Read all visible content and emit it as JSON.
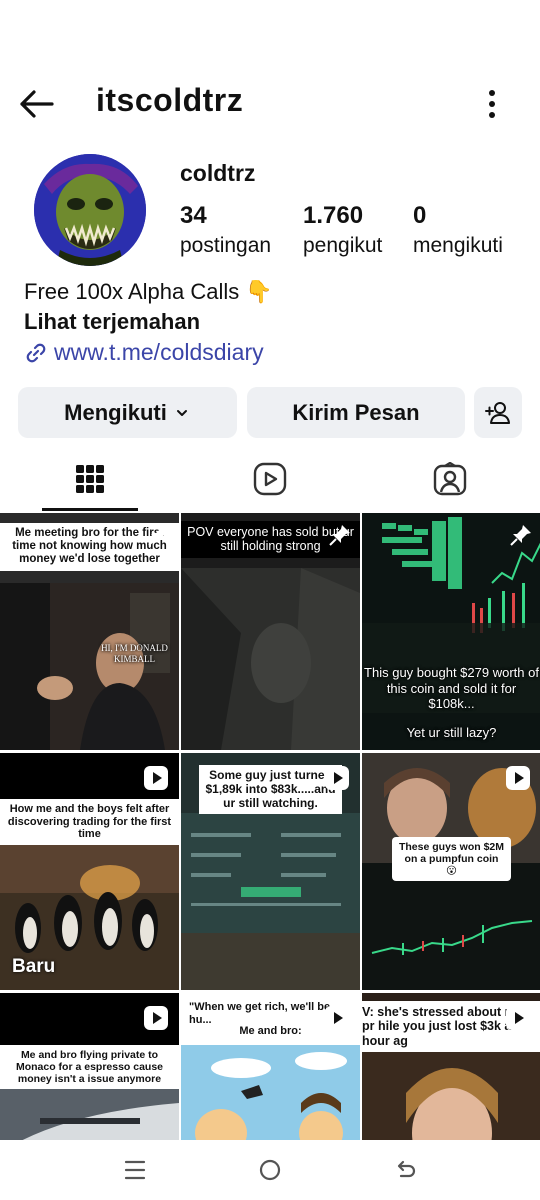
{
  "header": {
    "back_icon": "arrow-left-icon",
    "username": "itscoldtrz",
    "more_icon": "more-vertical-icon"
  },
  "profile": {
    "display_name": "coldtrz",
    "stats": [
      {
        "value": "34",
        "label": "postingan"
      },
      {
        "value": "1.760",
        "label": "pengikut"
      },
      {
        "value": "0",
        "label": "mengikuti"
      }
    ],
    "bio": "Free 100x Alpha Calls 👇",
    "translate": "Lihat terjemahan",
    "link": "www.t.me/coldsdiary"
  },
  "actions": {
    "follow": "Mengikuti",
    "message": "Kirim Pesan",
    "add_icon": "add-person-icon"
  },
  "tabs": [
    "grid-icon",
    "reels-icon",
    "tagged-icon"
  ],
  "posts": [
    {
      "caption": "Me meeting bro for the first time not knowing how much money we'd lose together",
      "overlay": "HI, I'M DONALD KIMBALL",
      "pinned": true
    },
    {
      "caption": "POV everyone has sold but ur still holding strong",
      "pinned": true
    },
    {
      "caption": "This guy bought $279 worth of this coin and sold it for $108k...",
      "caption2": "Yet ur still lazy?",
      "pinned": true
    },
    {
      "caption": "How me and the boys felt after discovering trading for the first time",
      "badge": "Baru",
      "reel": true
    },
    {
      "caption": "Some guy just turned $1,89k into $83k.....and ur still watching.",
      "reel": true
    },
    {
      "caption": "These guys won $2M on a pumpfun coin 😮",
      "reel": true
    },
    {
      "caption": "Me and bro flying private to Monaco for a espresso cause money isn't a issue anymore",
      "reel": true
    },
    {
      "caption": "\"When we get rich, we'll be hu...",
      "caption2": "Me and bro:",
      "reel": true
    },
    {
      "caption": "V: she's stressed about m... pr hile you just lost $3k a hour ag",
      "reel": true
    }
  ],
  "navbar": [
    "recent-apps-icon",
    "home-icon",
    "back-icon"
  ]
}
